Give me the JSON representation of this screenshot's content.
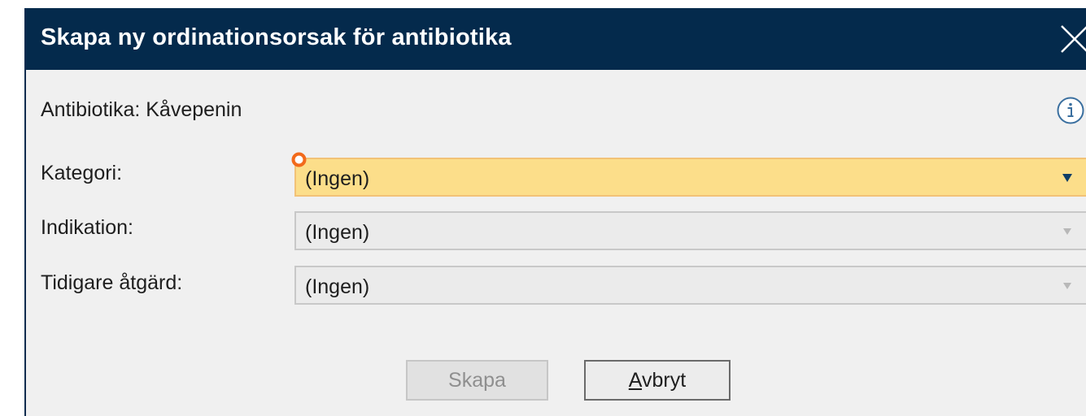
{
  "dialog": {
    "title": "Skapa ny ordinationsorsak för antibiotika",
    "antibiotic_label": "Antibiotika: Kåvepenin"
  },
  "fields": [
    {
      "label": "Kategori:",
      "value": "(Ingen)",
      "state": "active",
      "required": true
    },
    {
      "label": "Indikation:",
      "value": "(Ingen)",
      "state": "disabled",
      "required": false
    },
    {
      "label": "Tidigare åtgärd:",
      "value": "(Ingen)",
      "state": "disabled",
      "required": false
    }
  ],
  "buttons": {
    "create_label": "Skapa",
    "create_enabled": false,
    "cancel_label_mnemonic": "A",
    "cancel_label_rest": "vbryt"
  },
  "icons": {
    "close": "close-icon",
    "info": "info-icon",
    "dropdown": "triangle-down-icon",
    "required": "required-indicator-icon"
  },
  "colors": {
    "titlebar": "#042a4c",
    "active_field": "#fcde8a",
    "required_marker": "#f26a1b",
    "dropdown_arrow_active": "#0f3d66",
    "dropdown_arrow_disabled": "#b8b8b8"
  }
}
